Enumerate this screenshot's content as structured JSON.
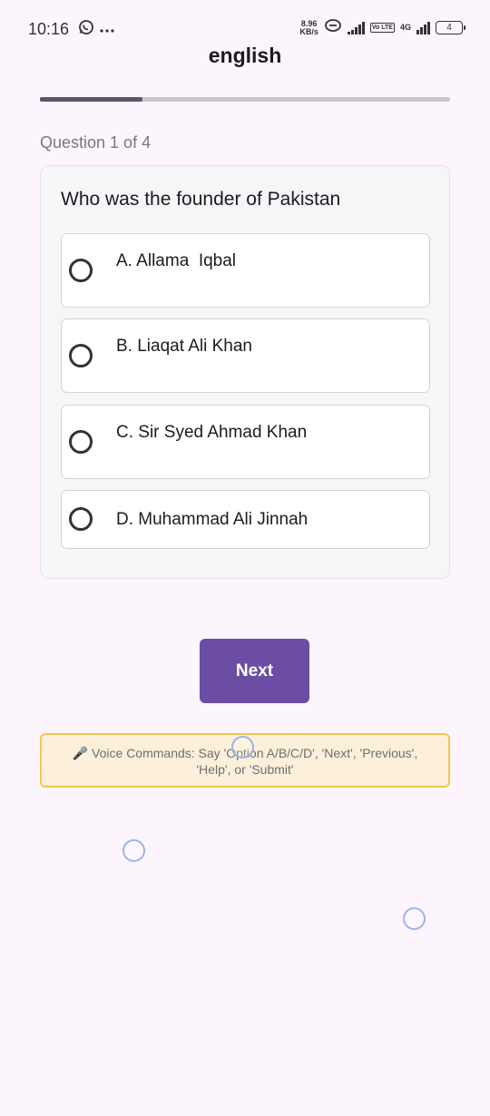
{
  "status_bar": {
    "time": "10:16",
    "speed_value": "8.96",
    "speed_unit": "KB/s",
    "volte": "Vo LTE",
    "network": "4G",
    "battery": "4"
  },
  "page": {
    "title": "english",
    "progress_fraction": 0.25,
    "question_counter": "Question 1 of 4"
  },
  "question": {
    "text": "Who was the founder of Pakistan",
    "options": [
      {
        "label": "A. Allama  Iqbal"
      },
      {
        "label": "B. Liaqat Ali Khan"
      },
      {
        "label": "C. Sir Syed Ahmad Khan"
      },
      {
        "label": "D. Muhammad Ali Jinnah"
      }
    ]
  },
  "actions": {
    "next_label": "Next"
  },
  "voice_commands": {
    "icon": "microphone-icon",
    "text_line1": "🎤 Voice Commands: Say 'Option A/B/C/D', 'Next', 'Previous',",
    "text_line2": "'Help', or 'Submit'"
  },
  "colors": {
    "background": "#fcf5fd",
    "accent": "#6b4ea3",
    "progress": "#5d5569",
    "voice_border": "#f5c44e",
    "voice_bg": "#fdf0db"
  }
}
